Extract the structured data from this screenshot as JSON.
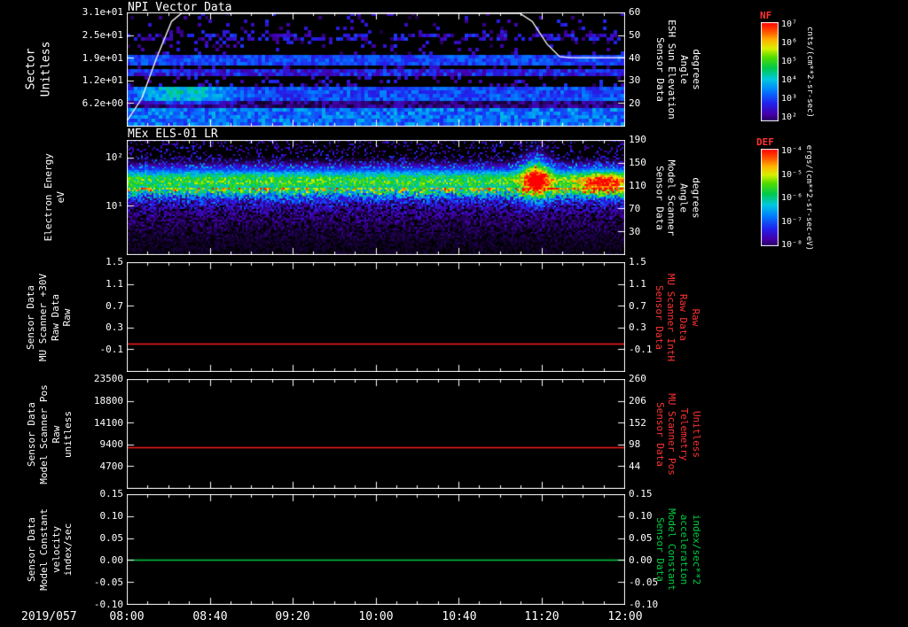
{
  "chart_data": {
    "type": "heatmap",
    "description": "Multi-panel time-series quicklook: two spectrogram panels (NPI sectors, MEx ELS-01 LR electron energy) and three flat line panels versus time.",
    "time_axis": {
      "date_label": "2019/057",
      "tick_labels": [
        "08:00",
        "08:40",
        "09:20",
        "10:00",
        "10:40",
        "11:20",
        "12:00"
      ],
      "minor_ticks_per_major": 4
    },
    "colormap": [
      {
        "pos": 0.0,
        "color": "#000000"
      },
      {
        "pos": 0.08,
        "color": "#1a0040"
      },
      {
        "pos": 0.16,
        "color": "#4400aa"
      },
      {
        "pos": 0.26,
        "color": "#2222ee"
      },
      {
        "pos": 0.38,
        "color": "#0080ff"
      },
      {
        "pos": 0.48,
        "color": "#00c8e0"
      },
      {
        "pos": 0.58,
        "color": "#00c850"
      },
      {
        "pos": 0.68,
        "color": "#50dc00"
      },
      {
        "pos": 0.76,
        "color": "#d8f000"
      },
      {
        "pos": 0.84,
        "color": "#ffb400"
      },
      {
        "pos": 0.92,
        "color": "#ff5000"
      },
      {
        "pos": 1.0,
        "color": "#ff0000"
      }
    ],
    "colorbars": [
      {
        "title": "NF",
        "title_color": "#ff3232",
        "tick_labels": [
          "10⁷",
          "10⁶",
          "10⁵",
          "10⁴",
          "10³",
          "10²"
        ],
        "tick_fracs": [
          0.03,
          0.21,
          0.4,
          0.59,
          0.78,
          0.96
        ],
        "units": "cnts/(cm**2-sr-sec)"
      },
      {
        "title": "DEF",
        "title_color": "#ff3232",
        "tick_labels": [
          "10⁻⁴",
          "10⁻⁵",
          "10⁻⁶",
          "10⁻⁷",
          "10⁻⁸"
        ],
        "tick_fracs": [
          0.03,
          0.27,
          0.51,
          0.75,
          0.99
        ],
        "units": "ergs/(cm**2-sr-sec-eV)"
      }
    ],
    "panels": [
      {
        "title": "NPI Vector Data",
        "kind": "spectrogram-npi",
        "left_label": "Sector\nUnitless",
        "left_ticks": [
          "3.1e+01",
          "2.5e+01",
          "1.9e+01",
          "1.2e+01",
          "6.2e+00"
        ],
        "left_tick_fracs": [
          0,
          0.2,
          0.4,
          0.6,
          0.8
        ],
        "right_ticks": [
          "60",
          "50",
          "40",
          "30",
          "20"
        ],
        "right_tick_fracs": [
          0,
          0.2,
          0.4,
          0.6,
          0.8
        ],
        "right_label": "Sensor Data\nESH Sun Elevation\nAngle\ndegrees",
        "right_label_color": "#ffffff",
        "sectors": 32,
        "bands": [
          {
            "s0": 0,
            "s1": 4,
            "level": 0.36,
            "noise": 0.1
          },
          {
            "s0": 5,
            "s1": 6,
            "level": 0.13,
            "noise": 0.08
          },
          {
            "s0": 7,
            "s1": 10,
            "level": 0.31,
            "noise": 0.08
          },
          {
            "s0": 11,
            "s1": 13,
            "level": 0.15,
            "noise": 0.1,
            "sparse": 0.2
          },
          {
            "s0": 14,
            "s1": 15,
            "level": 0.24,
            "noise": 0.1
          },
          {
            "s0": 16,
            "s1": 16,
            "level": 0.12,
            "noise": 0.08,
            "sparse": 0.15
          },
          {
            "s0": 17,
            "s1": 19,
            "level": 0.3,
            "noise": 0.07
          },
          {
            "s0": 20,
            "s1": 23,
            "level": 0.15,
            "noise": 0.1,
            "sparse": 0.13
          },
          {
            "s0": 24,
            "s1": 25,
            "level": 0.17,
            "noise": 0.1,
            "sparse": 0.5
          },
          {
            "s0": 26,
            "s1": 31,
            "level": 0.14,
            "noise": 0.1,
            "sparse": 0.11
          }
        ],
        "blob": {
          "t0": 0.0,
          "t1": 0.24,
          "s0": 6,
          "s1": 10,
          "boost": 0.2
        },
        "overlay_line": {
          "color": "#ffffff",
          "ylim": [
            10,
            60
          ],
          "points": [
            [
              0,
              12
            ],
            [
              0.03,
              22
            ],
            [
              0.06,
              40
            ],
            [
              0.09,
              56
            ],
            [
              0.11,
              60
            ],
            [
              0.79,
              60
            ],
            [
              0.815,
              56
            ],
            [
              0.845,
              46
            ],
            [
              0.87,
              40.5
            ],
            [
              0.89,
              40
            ],
            [
              1,
              40
            ]
          ]
        }
      },
      {
        "title": "MEx ELS-01 LR",
        "kind": "spectrogram-els",
        "left_label": "Electron Energy\neV",
        "left_ticks": [
          "10²",
          "10¹"
        ],
        "left_tick_fracs": [
          0.153,
          0.577
        ],
        "right_ticks": [
          "190",
          "150",
          "110",
          "70",
          "30"
        ],
        "right_tick_fracs": [
          0,
          0.2,
          0.4,
          0.6,
          0.8
        ],
        "right_label": "Sensor Data\nModel Scanner\nAngle\ndegrees",
        "right_label_color": "#ffffff",
        "band": {
          "center_f": 0.36,
          "sigma": 0.085,
          "amp": 0.62
        },
        "blobs": [
          {
            "t": 0.822,
            "tsig": 0.02,
            "f": 0.33,
            "fsig": 0.13,
            "amp": 0.6
          },
          {
            "t": 0.955,
            "tsig": 0.035,
            "f": 0.38,
            "fsig": 0.07,
            "amp": 0.45
          }
        ]
      },
      {
        "kind": "line",
        "left_label": "Sensor Data\nMU Scanner +30V\nRaw Data\nRaw",
        "left_ticks": [
          "1.5",
          "1.1",
          "0.7",
          "0.3",
          "-0.1"
        ],
        "left_tick_fracs": [
          0,
          0.2,
          0.4,
          0.6,
          0.8
        ],
        "right_ticks": [
          "1.5",
          "1.1",
          "0.7",
          "0.3",
          "-0.1"
        ],
        "right_tick_fracs": [
          0,
          0.2,
          0.4,
          0.6,
          0.8
        ],
        "right_label": "Sensor Data\nMU Scanner IntH\nRaw Data\nRaw",
        "right_label_color": "#ff3232",
        "line": {
          "color": "#ff1a1a",
          "value": 0.0,
          "ylim": [
            -0.5,
            1.5
          ]
        }
      },
      {
        "kind": "line",
        "left_label": "Sensor Data\nModel Scanner Pos\nRaw\nunitless",
        "left_ticks": [
          "23500",
          "18800",
          "14100",
          "9400",
          "4700"
        ],
        "left_tick_fracs": [
          0,
          0.2,
          0.4,
          0.6,
          0.8
        ],
        "right_ticks": [
          "260",
          "206",
          "152",
          "98",
          "44"
        ],
        "right_tick_fracs": [
          0,
          0.2,
          0.4,
          0.6,
          0.8
        ],
        "right_label": "Sensor Data\nMU Scanner Pos\nTelemetry\nUnitless",
        "right_label_color": "#ff3232",
        "line": {
          "color": "#ff1a1a",
          "value": 8800,
          "right_value": 91,
          "ylim": [
            0,
            23500
          ]
        }
      },
      {
        "kind": "line",
        "left_label": "Sensor Data\nModel Constant\nvelocity\nindex/sec",
        "left_ticks": [
          "0.15",
          "0.10",
          "0.05",
          "0.00",
          "-0.05",
          "-0.10"
        ],
        "left_tick_fracs": [
          0,
          0.2,
          0.4,
          0.6,
          0.8,
          1
        ],
        "right_ticks": [
          "0.15",
          "0.10",
          "0.05",
          "0.00",
          "-0.05",
          "-0.10"
        ],
        "right_tick_fracs": [
          0,
          0.2,
          0.4,
          0.6,
          0.8,
          1
        ],
        "right_label": "Sensor Data\nModel Constant\nacceleration\nindex/sec**2",
        "right_label_color": "#00d040",
        "line": {
          "color": "#00cc44",
          "value": 0.0,
          "ylim": [
            -0.1,
            0.15
          ]
        }
      }
    ]
  }
}
